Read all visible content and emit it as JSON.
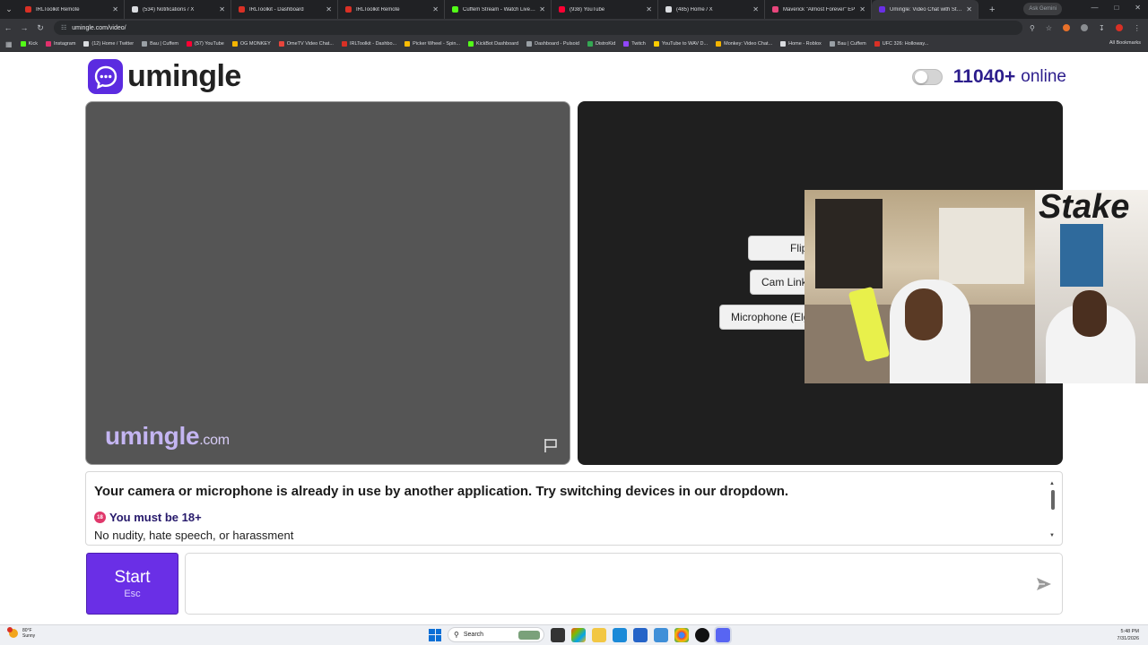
{
  "browser": {
    "tabs": [
      {
        "title": "IRLToolkit Remote",
        "color": "#d93025",
        "active": false
      },
      {
        "title": "(534) Notifications / X",
        "color": "#dadce0",
        "active": false
      },
      {
        "title": "IRLToolkit - Dashboard",
        "color": "#d93025",
        "active": false
      },
      {
        "title": "IRLToolkit Remote",
        "color": "#d93025",
        "active": false
      },
      {
        "title": "Cuffem Stream - Watch Live on Kick",
        "color": "#53fc18",
        "active": false
      },
      {
        "title": "(938) YouTube",
        "color": "#ff0033",
        "active": false
      },
      {
        "title": "(485) Home / X",
        "color": "#dadce0",
        "active": false
      },
      {
        "title": "Maverick \"Almost Forever\" EP",
        "color": "#e8467c",
        "active": false
      },
      {
        "title": "Umingle: Video Chat with Strangers",
        "color": "#6a2fe6",
        "active": true
      }
    ],
    "ask_label": "Ask Gemini",
    "url": "umingle.com/video/",
    "bookmarks": [
      {
        "label": "Kick",
        "color": "#53fc18"
      },
      {
        "label": "Instagram",
        "color": "#e1306c"
      },
      {
        "label": "(12) Home / Twitter",
        "color": "#dadce0"
      },
      {
        "label": "Bau | Cuffem",
        "color": "#9aa0a6"
      },
      {
        "label": "(57) YouTube",
        "color": "#ff0033"
      },
      {
        "label": "OG MONKEY",
        "color": "#f4b400"
      },
      {
        "label": "OmeTV Video Chat...",
        "color": "#e8453c"
      },
      {
        "label": "IRLToolkit - Dashbo...",
        "color": "#d93025"
      },
      {
        "label": "Picker Wheel - Spin...",
        "color": "#fbbc04"
      },
      {
        "label": "KickBot Dashboard",
        "color": "#53fc18"
      },
      {
        "label": "Dashboard - Pulsoid",
        "color": "#9aa0a6"
      },
      {
        "label": "DistroKid",
        "color": "#34a853"
      },
      {
        "label": "Twitch",
        "color": "#9146ff"
      },
      {
        "label": "YouTube to WAV D...",
        "color": "#ffcc00"
      },
      {
        "label": "Monkey: Video Chat...",
        "color": "#f4b400"
      },
      {
        "label": "Home - Roblox",
        "color": "#dadce0"
      },
      {
        "label": "Bau | Cuffem",
        "color": "#9aa0a6"
      },
      {
        "label": "UFC 326: Holloway...",
        "color": "#d93025"
      }
    ],
    "all_bookmarks": "All Bookmarks"
  },
  "page": {
    "logo_text": "umingle",
    "online_count": "11040+",
    "online_label": "online",
    "watermark": "umingle",
    "watermark_domain": ".com",
    "device_buttons": [
      "Flip",
      "Cam Link",
      "Microphone (Elg"
    ],
    "overlay_brand": "Stake",
    "error_message": "Your camera or microphone is already in use by another application. Try switching devices in our dropdown.",
    "age_icon": "18",
    "age_notice": "You must be 18+",
    "rules": "No nudity, hate speech, or harassment",
    "start_label": "Start",
    "start_shortcut": "Esc",
    "chat_placeholder": "",
    "accent_color": "#6a2fe6"
  },
  "taskbar": {
    "temperature": "80°F",
    "weather": "Sunny",
    "search_label": "Search",
    "time": "5:48 PM",
    "date": "7/31/2026"
  }
}
